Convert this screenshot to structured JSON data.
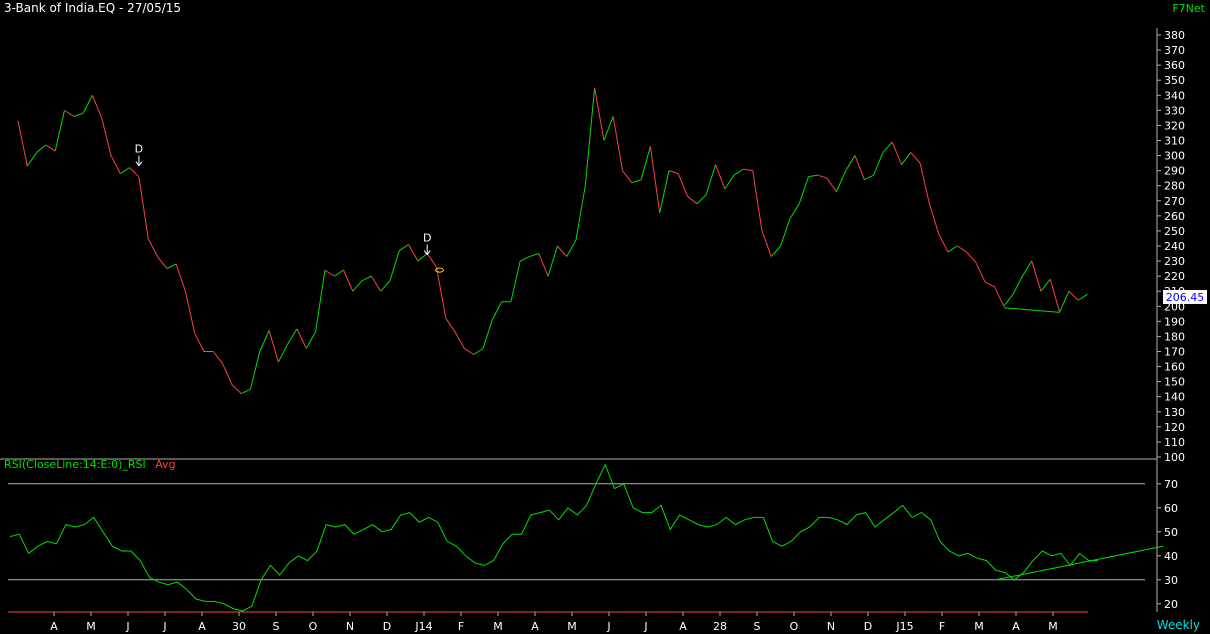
{
  "header": {
    "title": "3-Bank of India.EQ - 27/05/15",
    "brand": "F7Net"
  },
  "footer": {
    "period": "Weekly"
  },
  "last_price_label": "206.45",
  "colors": {
    "background": "#000000",
    "up": "#00e000",
    "down": "#ff4040",
    "rsi_line": "#00e000",
    "avg_label": "#ff4040",
    "level_line": "#b0b0b0",
    "price_box_bg": "#ffffff",
    "price_box_text": "#0000ff",
    "text": "#ffffff"
  },
  "rsi_legend": {
    "rsi_text": "RSI(CloseLine:14:E:0)_RSI",
    "avg_text": "Avg"
  },
  "chart_data": [
    {
      "type": "line",
      "name": "price",
      "ylim": [
        100,
        380
      ],
      "yticks": [
        100,
        110,
        120,
        130,
        140,
        150,
        160,
        170,
        180,
        190,
        200,
        210,
        220,
        230,
        240,
        250,
        260,
        270,
        280,
        290,
        300,
        310,
        320,
        330,
        340,
        350,
        360,
        370,
        380
      ],
      "xtick_labels": [
        "A",
        "M",
        "J",
        "J",
        "A",
        "30",
        "S",
        "O",
        "N",
        "D",
        "J14",
        "F",
        "M",
        "A",
        "M",
        "J",
        "J",
        "A",
        "28",
        "S",
        "O",
        "N",
        "D",
        "J15",
        "F",
        "M",
        "A",
        "M"
      ],
      "values": [
        323,
        293,
        302,
        307,
        303,
        330,
        326,
        328,
        340,
        325,
        300,
        288,
        292,
        286,
        245,
        233,
        225,
        228,
        210,
        182,
        170,
        170,
        162,
        148,
        142,
        145,
        170,
        184,
        163,
        175,
        185,
        172,
        183,
        224,
        220,
        224,
        210,
        217,
        220,
        210,
        217,
        237,
        241,
        230,
        235,
        226,
        192,
        183,
        172,
        168,
        172,
        191,
        203,
        203,
        230,
        233,
        235,
        220,
        240,
        233,
        244,
        280,
        345,
        310,
        326,
        290,
        282,
        284,
        306,
        262,
        290,
        288,
        273,
        268,
        274,
        294,
        278,
        287,
        291,
        290,
        250,
        233,
        240,
        258,
        268,
        286,
        287,
        285,
        276,
        290,
        300,
        284,
        287,
        302,
        309,
        294,
        302,
        295,
        268,
        248,
        236,
        240,
        236,
        229,
        216,
        213,
        200,
        208,
        220,
        230,
        210,
        218,
        196,
        210,
        204,
        208
      ],
      "trendline": [
        [
          106,
          199
        ],
        [
          112,
          196
        ]
      ],
      "annotations": [
        {
          "label": "D",
          "index": 13,
          "value": 290
        },
        {
          "label": "D",
          "index": 44,
          "value": 231
        }
      ],
      "last_value": 206.45
    },
    {
      "type": "line",
      "name": "RSI",
      "ylim": [
        17,
        77
      ],
      "yticks": [
        20,
        30,
        40,
        50,
        60,
        70
      ],
      "levels": [
        30,
        70
      ],
      "values": [
        48,
        49,
        41,
        44,
        46,
        45,
        53,
        52,
        53,
        56,
        50,
        44,
        42,
        42,
        38,
        31,
        29,
        28,
        29,
        26,
        22,
        21,
        21,
        20,
        18,
        17,
        19,
        30,
        36,
        32,
        37,
        40,
        38,
        42,
        53,
        52,
        53,
        49,
        51,
        53,
        50,
        51,
        57,
        58,
        54,
        56,
        54,
        46,
        44,
        40,
        37,
        36,
        38,
        45,
        49,
        49,
        57,
        58,
        59,
        55,
        60,
        57,
        61,
        70,
        78,
        68,
        70,
        60,
        58,
        58,
        61,
        51,
        57,
        55,
        53,
        52,
        53,
        56,
        53,
        55,
        56,
        56,
        46,
        44,
        46,
        50,
        52,
        56,
        56,
        55,
        53,
        57,
        58,
        52,
        55,
        58,
        61,
        56,
        58,
        55,
        46,
        42,
        40,
        41,
        39,
        38,
        34,
        33,
        30,
        33,
        38,
        42,
        40,
        41,
        36,
        41,
        38,
        38
      ],
      "trendline": [
        [
          106,
          30
        ],
        [
          124,
          44
        ]
      ]
    }
  ]
}
